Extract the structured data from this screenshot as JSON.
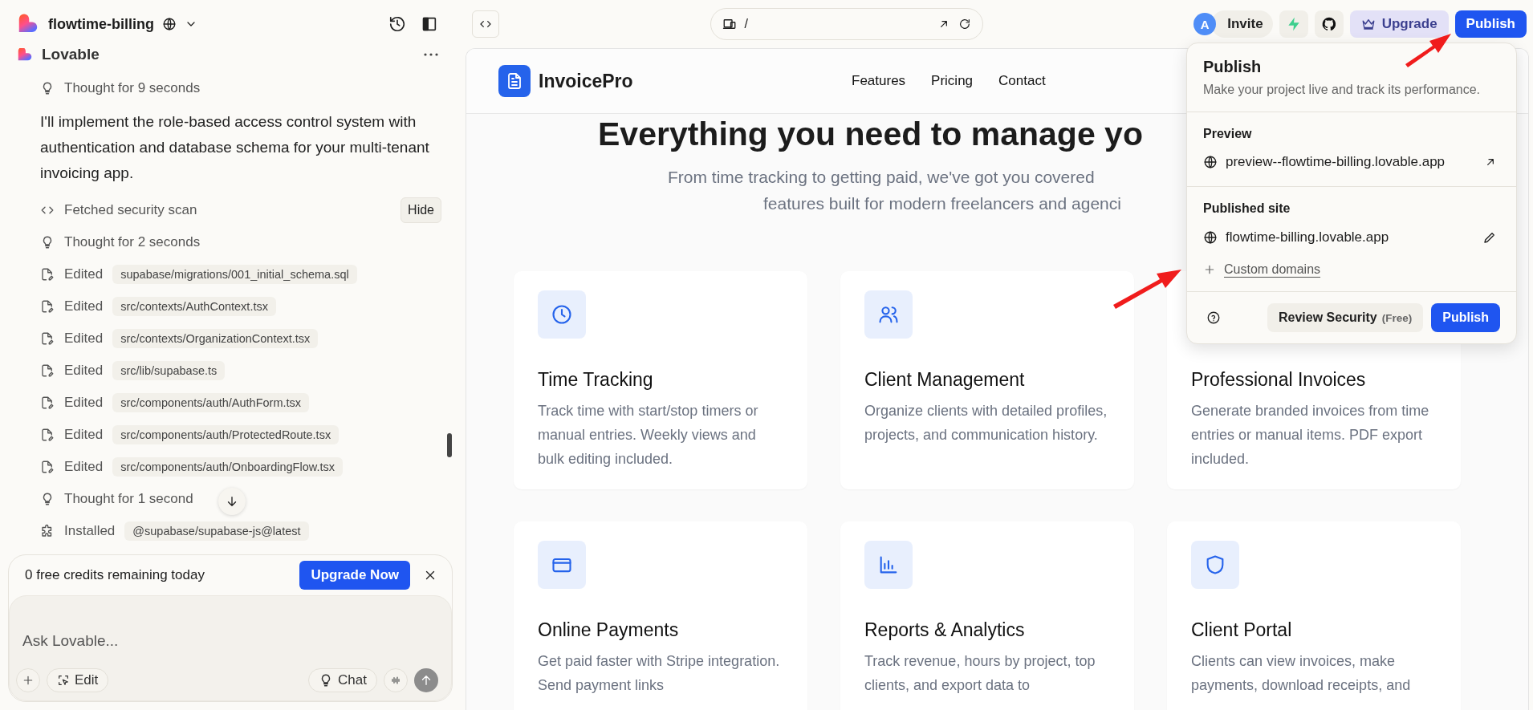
{
  "header": {
    "project_name": "flowtime-billing"
  },
  "chat": {
    "sender": "Lovable",
    "items": [
      {
        "kind": "thought",
        "label": "Thought for 9 seconds"
      },
      {
        "kind": "message",
        "text": "I'll implement the role-based access control system with authentication and database schema for your multi-tenant invoicing app."
      },
      {
        "kind": "tool",
        "label": "Fetched security scan",
        "action": "Hide"
      },
      {
        "kind": "thought",
        "label": "Thought for 2 seconds"
      },
      {
        "kind": "edit",
        "label": "Edited",
        "file": "supabase/migrations/001_initial_schema.sql"
      },
      {
        "kind": "edit",
        "label": "Edited",
        "file": "src/contexts/AuthContext.tsx"
      },
      {
        "kind": "edit",
        "label": "Edited",
        "file": "src/contexts/OrganizationContext.tsx"
      },
      {
        "kind": "edit",
        "label": "Edited",
        "file": "src/lib/supabase.ts"
      },
      {
        "kind": "edit",
        "label": "Edited",
        "file": "src/components/auth/AuthForm.tsx"
      },
      {
        "kind": "edit",
        "label": "Edited",
        "file": "src/components/auth/ProtectedRoute.tsx"
      },
      {
        "kind": "edit",
        "label": "Edited",
        "file": "src/components/auth/OnboardingFlow.tsx"
      },
      {
        "kind": "thought",
        "label": "Thought for 1 second"
      },
      {
        "kind": "install",
        "label": "Installed",
        "file": "@supabase/supabase-js@latest"
      }
    ]
  },
  "credits_banner": {
    "text": "0 free credits remaining today",
    "button": "Upgrade Now"
  },
  "composer": {
    "placeholder": "Ask Lovable...",
    "edit_button": "Edit",
    "chat_button": "Chat"
  },
  "address_bar": {
    "path": "/"
  },
  "toolbar": {
    "avatar": "A",
    "invite": "Invite",
    "upgrade": "Upgrade",
    "publish": "Publish"
  },
  "preview": {
    "brand": "InvoicePro",
    "nav": [
      "Features",
      "Pricing",
      "Contact"
    ],
    "heading": "Everything you need to manage yo",
    "subtitle_lines": [
      "From time tracking to getting paid, we've got you covered",
      "features built for modern freelancers and agenci"
    ],
    "features": [
      {
        "title": "Time Tracking",
        "description": "Track time with start/stop timers or manual entries. Weekly views and bulk editing included."
      },
      {
        "title": "Client Management",
        "description": "Organize clients with detailed profiles, projects, and communication history."
      },
      {
        "title": "Professional Invoices",
        "description": "Generate branded invoices from time entries or manual items. PDF export included."
      },
      {
        "title": "Online Payments",
        "description": "Get paid faster with Stripe integration. Send payment links"
      },
      {
        "title": "Reports & Analytics",
        "description": "Track revenue, hours by project, top clients, and export data to"
      },
      {
        "title": "Client Portal",
        "description": "Clients can view invoices, make payments, download receipts, and"
      }
    ]
  },
  "publish_popover": {
    "title": "Publish",
    "subtitle": "Make your project live and track its performance.",
    "preview_heading": "Preview",
    "preview_url": "preview--flowtime-billing.lovable.app",
    "published_heading": "Published site",
    "published_url": "flowtime-billing.lovable.app",
    "custom_domains": "Custom domains",
    "review_button": "Review Security",
    "review_note": "(Free)",
    "publish_button": "Publish"
  }
}
